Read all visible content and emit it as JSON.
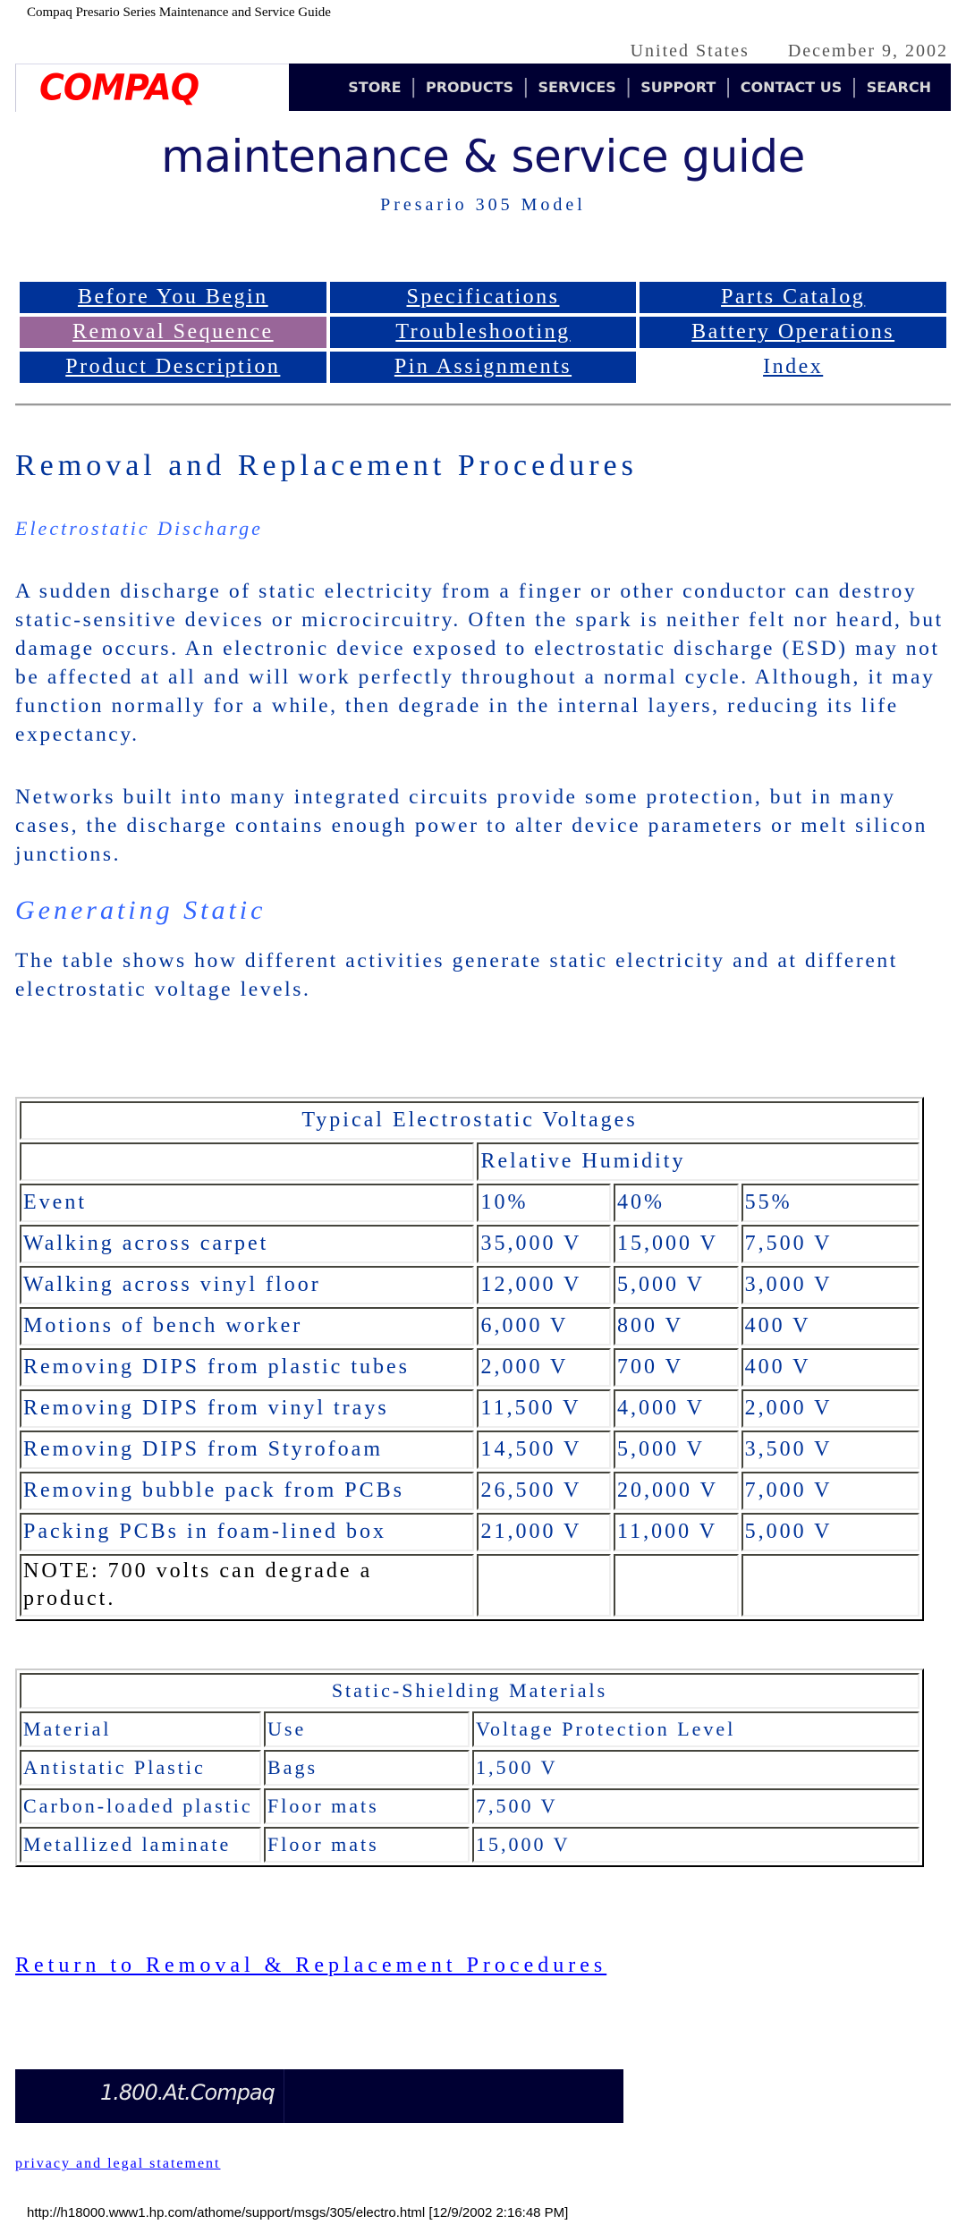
{
  "print_header": "Compaq Presario Series Maintenance and Service Guide",
  "topbar": {
    "country": "United States",
    "date": "December 9, 2002"
  },
  "brand": {
    "logo_text": "COMPAQ",
    "logo_color": "#ff0000"
  },
  "top_nav": [
    "STORE",
    "PRODUCTS",
    "SERVICES",
    "SUPPORT",
    "CONTACT US",
    "SEARCH"
  ],
  "guide_title": "maintenance & service guide",
  "model": "Presario 305 Model",
  "section_nav": {
    "rows": [
      [
        {
          "label": "Before You Begin"
        },
        {
          "label": "Specifications"
        },
        {
          "label": "Parts Catalog"
        }
      ],
      [
        {
          "label": "Removal Sequence",
          "active": true
        },
        {
          "label": "Troubleshooting"
        },
        {
          "label": "Battery Operations"
        }
      ],
      [
        {
          "label": "Product Description"
        },
        {
          "label": "Pin Assignments"
        },
        {
          "label": "Index",
          "plain": true
        }
      ]
    ],
    "colors": {
      "default": "#003399",
      "active": "#996699"
    }
  },
  "content": {
    "title": "Removal and Replacement Procedures",
    "subtitle": "Electrostatic Discharge",
    "paragraph1": "A sudden discharge of static electricity from a finger or other conductor can destroy static-sensitive devices or microcircuitry. Often the spark is neither felt nor heard, but damage occurs. An electronic device exposed to electrostatic discharge (ESD) may not be affected at all and will work perfectly throughout a normal cycle. Although, it may function normally for a while, then degrade in the internal layers, reducing its life expectancy.",
    "paragraph2": "Networks built into many integrated circuits provide some protection, but in many cases, the discharge contains enough power to alter device parameters or melt silicon junctions.",
    "section2_title": "Generating Static",
    "paragraph3": "The table shows how different activities generate static electricity and at different electrostatic voltage levels."
  },
  "voltages_table": {
    "caption": "Typical Electrostatic Voltages",
    "group_header": "Relative Humidity",
    "columns": [
      "Event",
      "10%",
      "40%",
      "55%"
    ],
    "rows": [
      [
        "Walking across carpet",
        "35,000 V",
        "15,000 V",
        "7,500 V"
      ],
      [
        "Walking across vinyl floor",
        "12,000 V",
        "5,000 V",
        "3,000 V"
      ],
      [
        "Motions of bench worker",
        "6,000 V",
        "800 V",
        "400 V"
      ],
      [
        "Removing DIPS from plastic tubes",
        "2,000 V",
        "700 V",
        "400 V"
      ],
      [
        "Removing DIPS from vinyl trays",
        "11,500 V",
        "4,000 V",
        "2,000 V"
      ],
      [
        "Removing DIPS from Styrofoam",
        "14,500 V",
        "5,000 V",
        "3,500 V"
      ],
      [
        "Removing bubble pack from PCBs",
        "26,500 V",
        "20,000 V",
        "7,000 V"
      ],
      [
        "Packing PCBs in foam-lined box",
        "21,000 V",
        "11,000 V",
        "5,000 V"
      ]
    ],
    "note": "NOTE:  700 volts can degrade a product."
  },
  "shielding_table": {
    "caption": "Static-Shielding Materials",
    "columns": [
      "Material",
      "Use",
      "Voltage Protection Level"
    ],
    "rows": [
      [
        "Antistatic Plastic",
        "Bags",
        "1,500 V"
      ],
      [
        "Carbon-loaded plastic",
        "Floor mats",
        "7,500 V"
      ],
      [
        "Metallized laminate",
        "Floor mats",
        "15,000 V"
      ]
    ]
  },
  "return_link": "Return to Removal & Replacement Procedures",
  "phone_banner": "1.800.At.Compaq",
  "privacy_link": "privacy and legal statement",
  "footer_url": "http://h18000.www1.hp.com/athome/support/msgs/305/electro.html [12/9/2002 2:16:48 PM]"
}
